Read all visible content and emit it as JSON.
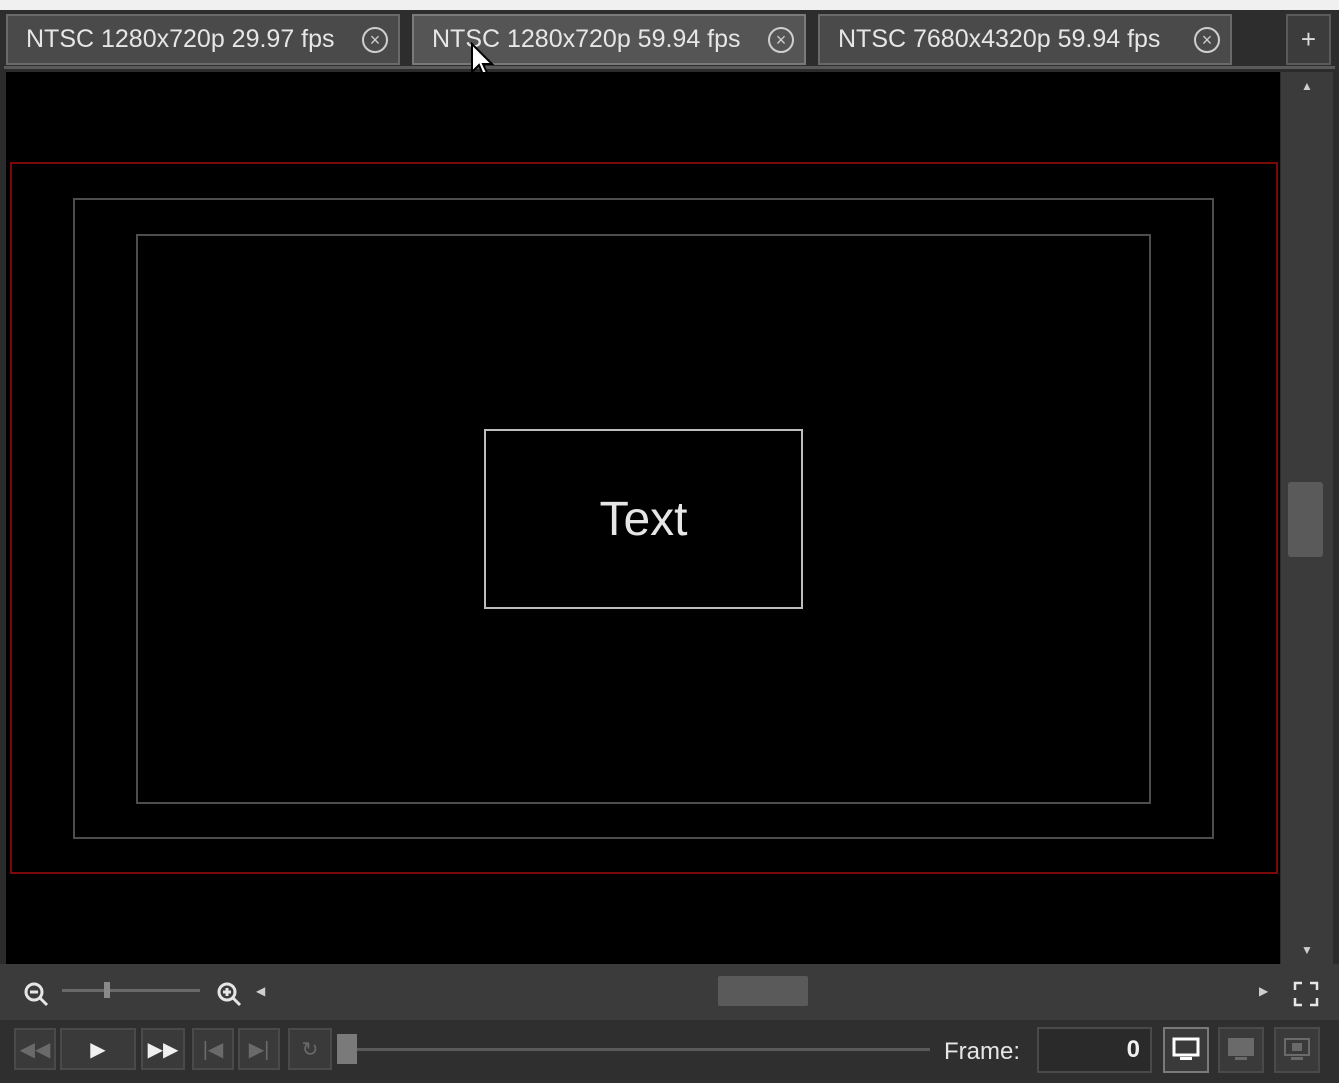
{
  "tabs": [
    {
      "label": "NTSC 1280x720p 29.97 fps",
      "active": false
    },
    {
      "label": "NTSC 1280x720p 59.94 fps",
      "active": true
    },
    {
      "label": "NTSC 7680x4320p 59.94 fps",
      "active": false
    }
  ],
  "add_tab_label": "+",
  "viewport": {
    "text_element": "Text"
  },
  "transport": {
    "frame_label": "Frame:",
    "frame_value": "0"
  },
  "icons": {
    "close": "close-circle-icon",
    "zoom_out": "zoom-out-icon",
    "zoom_in": "zoom-in-icon",
    "fit": "fullscreen-icon",
    "rewind": "rewind-icon",
    "play": "play-icon",
    "fast_forward": "fast-forward-icon",
    "go_start": "go-to-start-icon",
    "go_end": "go-to-end-icon",
    "loop": "loop-icon",
    "monitor": "monitor-icon",
    "safe_area": "safe-area-icon",
    "preview": "preview-icon"
  },
  "colors": {
    "safe_area_border": "#7a0a0a",
    "background": "#000000"
  }
}
